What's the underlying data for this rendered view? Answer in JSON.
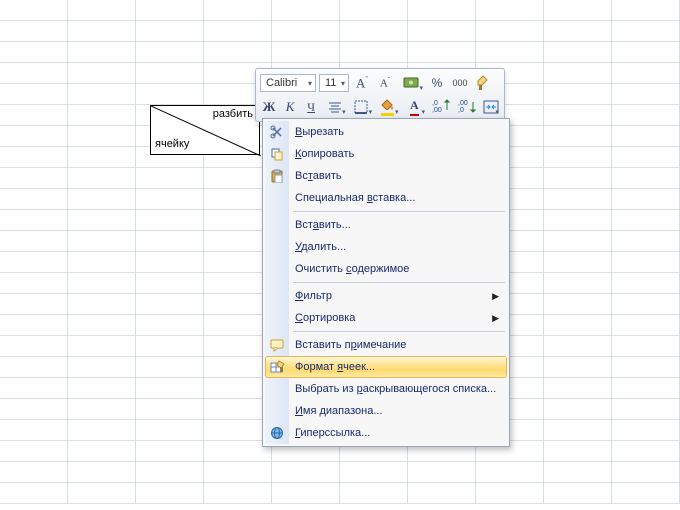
{
  "cell_text": {
    "top": "разбить",
    "bottom": "ячейку"
  },
  "toolbar": {
    "font_name": "Calibri",
    "font_size": "11",
    "percent_symbol": "%",
    "thousands": "000",
    "bold": "Ж",
    "italic": "К",
    "underline": "Ч",
    "font_color_letter": "A",
    "increase_decimal": ",0",
    "decrease_decimal": ",00"
  },
  "menu": {
    "cut": "Вырезать",
    "copy": "Копировать",
    "paste": "Вставить",
    "paste_special": "Специальная вставка...",
    "insert": "Вставить...",
    "delete": "Удалить...",
    "clear_contents": "Очистить содержимое",
    "filter": "Фильтр",
    "sort": "Сортировка",
    "insert_comment": "Вставить примечание",
    "format_cells": "Формат ячеек...",
    "pick_from_list": "Выбрать из раскрывающегося списка...",
    "name_range": "Имя диапазона...",
    "hyperlink": "Гиперссылка..."
  },
  "underline_positions": {
    "cut": 0,
    "copy": 0,
    "paste": 2,
    "paste_special": 12,
    "insert": 3,
    "delete": 0,
    "clear_contents": 9,
    "filter": 0,
    "sort": 0,
    "insert_comment": 10,
    "format_cells": 7,
    "pick_from_list": 11,
    "name_range": 0,
    "hyperlink": 0
  }
}
